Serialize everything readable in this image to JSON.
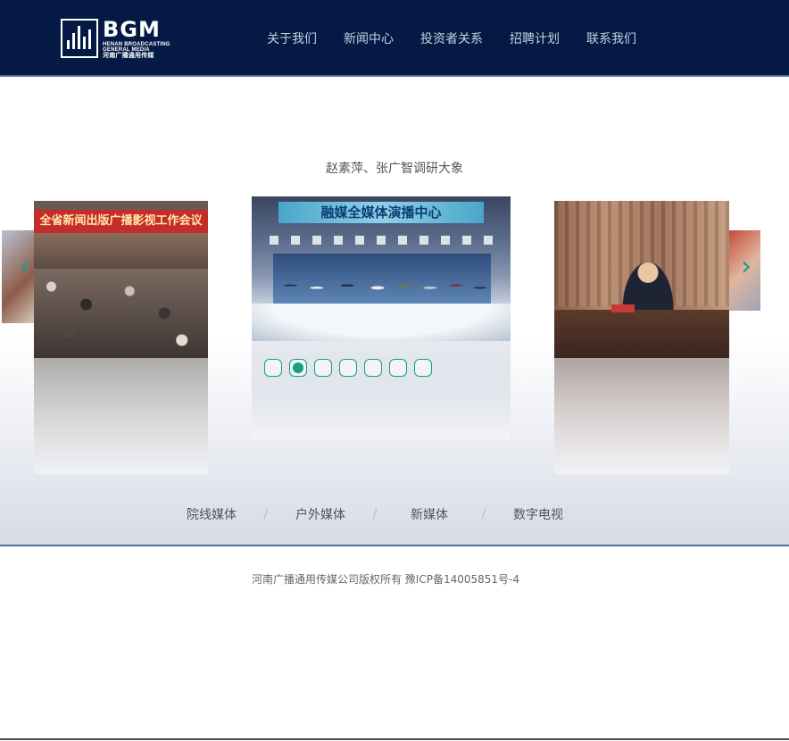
{
  "header": {
    "logo": {
      "name": "BGM",
      "sub_line_1": "HENAN BROADCASTING",
      "sub_line_2": "GENERAL MEDIA",
      "sub_line_3": "河南广播通用传媒"
    },
    "nav": [
      {
        "label": "关于我们"
      },
      {
        "label": "新闻中心"
      },
      {
        "label": "投资者关系"
      },
      {
        "label": "招聘计划"
      },
      {
        "label": "联系我们"
      }
    ]
  },
  "carousel": {
    "caption": "赵素萍、张广智调研大象",
    "slides": [
      {
        "banner": "全省新闻出版广播影视工作会议"
      },
      {
        "banner": "融媒全媒体演播中心"
      },
      {
        "banner": ""
      }
    ],
    "dots_total": 7,
    "active_dot": 2,
    "arrow_left": "‹",
    "arrow_right": "›"
  },
  "categories": [
    "院线媒体",
    "户外媒体",
    "新媒体",
    "数字电视"
  ],
  "category_separator": "/",
  "footer": {
    "copyright": "河南广播通用传媒公司版权所有 豫ICP备14005851号-4"
  },
  "colors": {
    "header_bg": "#041a44",
    "accent": "#14a085",
    "border_blue": "#4f6d9a"
  }
}
